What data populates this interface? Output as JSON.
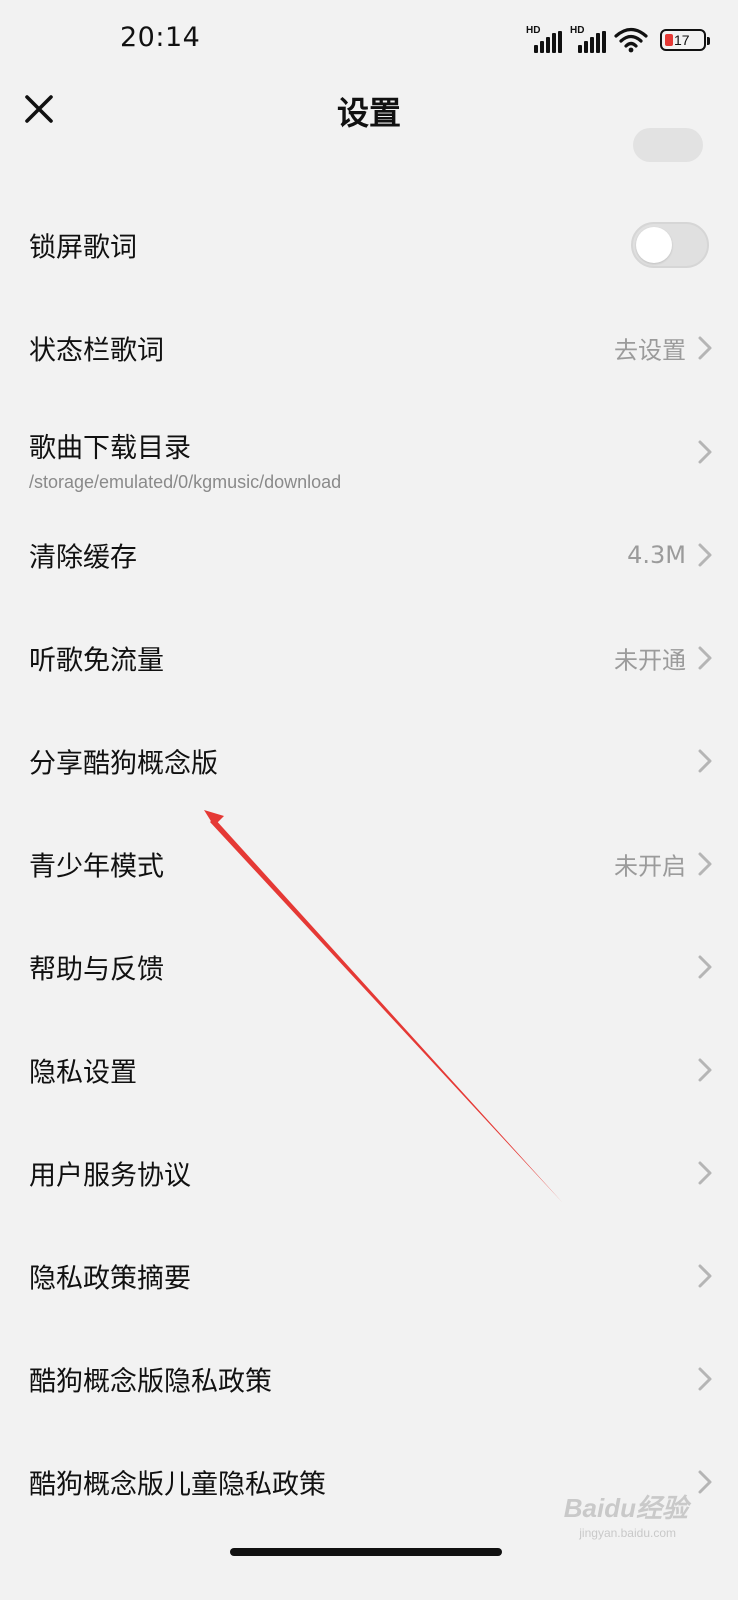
{
  "status_bar": {
    "time": "20:14",
    "network_1": "HD",
    "network_2": "HD",
    "battery_level": "17",
    "battery_color": "#e53935"
  },
  "header": {
    "title": "设置",
    "close_icon": "close-icon"
  },
  "settings": [
    {
      "label": "锁屏歌词",
      "control": "toggle",
      "toggle_on": false
    },
    {
      "label": "状态栏歌词",
      "value": "去设置"
    },
    {
      "label": "歌曲下载目录",
      "sub": "/storage/emulated/0/kgmusic/download"
    },
    {
      "label": "清除缓存",
      "value": "4.3M"
    },
    {
      "label": "听歌免流量",
      "value": "未开通"
    },
    {
      "label": "分享酷狗概念版"
    },
    {
      "label": "青少年模式",
      "value": "未开启"
    },
    {
      "label": "帮助与反馈"
    },
    {
      "label": "隐私设置"
    },
    {
      "label": "用户服务协议"
    },
    {
      "label": "隐私政策摘要"
    },
    {
      "label": "酷狗概念版隐私政策"
    },
    {
      "label": "酷狗概念版儿童隐私政策"
    }
  ],
  "annotation": {
    "color": "#e53935",
    "target": "分享酷狗概念版"
  },
  "watermark": {
    "brand": "Baidu经验",
    "sub": "jingyan.baidu.com"
  }
}
